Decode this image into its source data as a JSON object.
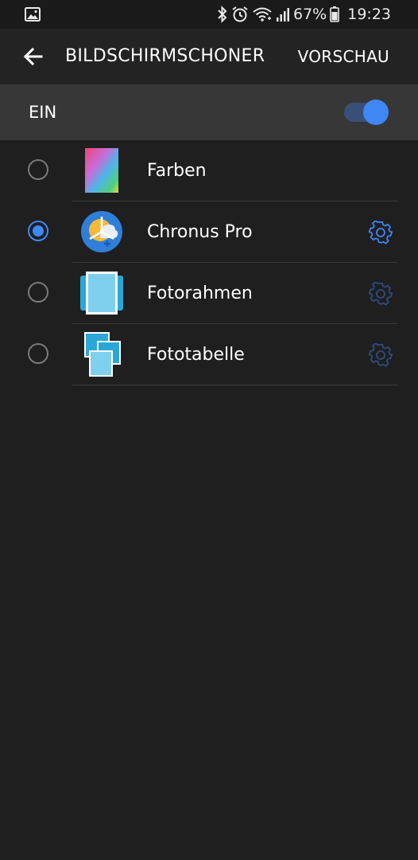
{
  "status_bar": {
    "notification_icon": "image-icon",
    "icons": [
      "bluetooth-icon",
      "alarm-icon",
      "wifi-icon",
      "signal-icon"
    ],
    "battery": "67%",
    "battery_icon": "battery-icon",
    "time": "19:23"
  },
  "app_bar": {
    "back_icon": "arrow-left-icon",
    "title": "BILDSCHIRMSCHONER",
    "preview_label": "VORSCHAU"
  },
  "master_switch": {
    "label": "EIN",
    "on": true
  },
  "colors": {
    "accent": "#3f87f5",
    "background": "#1f1f1f",
    "app_bar": "#232323",
    "switch_bar": "#373737"
  },
  "screensavers": [
    {
      "label": "Farben",
      "selected": false,
      "icon": "colors-gradient-icon",
      "has_settings": false
    },
    {
      "label": "Chronus Pro",
      "selected": true,
      "icon": "chronus-pro-icon",
      "has_settings": true,
      "settings_enabled": true
    },
    {
      "label": "Fotorahmen",
      "selected": false,
      "icon": "photo-frame-icon",
      "has_settings": true,
      "settings_enabled": false
    },
    {
      "label": "Fototabelle",
      "selected": false,
      "icon": "photo-table-icon",
      "has_settings": true,
      "settings_enabled": false
    }
  ]
}
